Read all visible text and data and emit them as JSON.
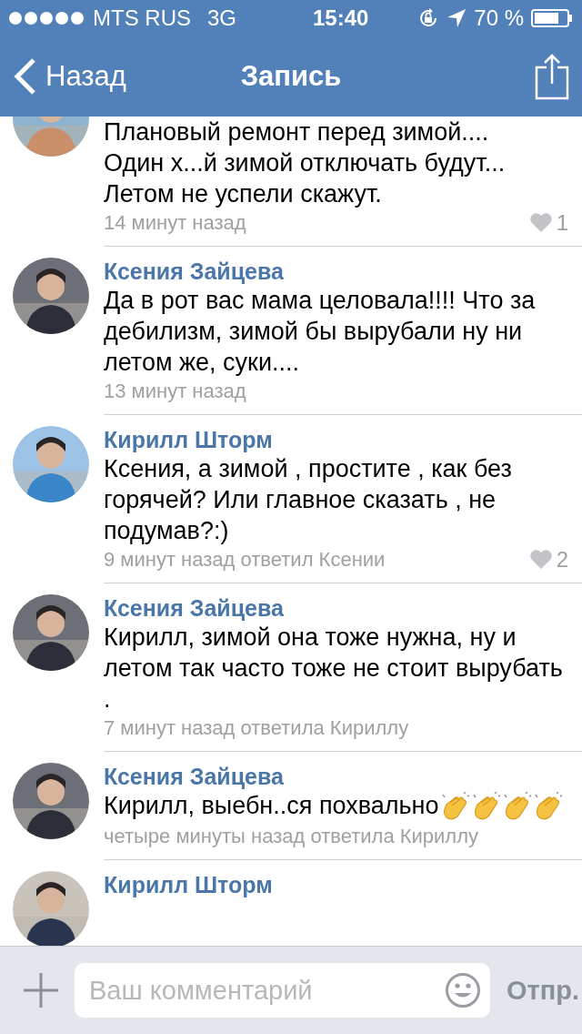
{
  "status_bar": {
    "carrier": "MTS RUS",
    "network": "3G",
    "time": "15:40",
    "battery": "70 %"
  },
  "nav": {
    "back": "Назад",
    "title": "Запись"
  },
  "comments": [
    {
      "text": "Плановый ремонт перед зимой....\nОдин х...й зимой отключать будут...\nЛетом не успели скажут.",
      "time": "14 минут назад",
      "likes": "1"
    },
    {
      "author": "Ксения Зайцева",
      "text": "Да в рот вас мама целовала!!!! Что за дебилизм, зимой бы вырубали ну ни летом же, суки....",
      "time": "13 минут назад"
    },
    {
      "author": "Кирилл Шторм",
      "text": "Ксения, а зимой , простите , как без горячей? Или главное сказать , не подумав?:)",
      "time": "9 минут назад ответил Ксении",
      "likes": "2"
    },
    {
      "author": "Ксения Зайцева",
      "text": "Кирилл, зимой она тоже нужна,  ну и летом так часто тоже не стоит вырубать .",
      "time": "7 минут назад ответила Кириллу"
    },
    {
      "author": "Ксения Зайцева",
      "text": "Кирилл, выебн..ся похвально",
      "emoji": [
        {
          "kind": "clap"
        },
        {
          "kind": "clap"
        },
        {
          "kind": "clap"
        },
        {
          "kind": "clap"
        }
      ],
      "time": "четыре минуты назад ответила Кириллу"
    },
    {
      "author": "Кирилл Шторм"
    }
  ],
  "composer": {
    "placeholder": "Ваш комментарий",
    "send": "Отпр."
  }
}
